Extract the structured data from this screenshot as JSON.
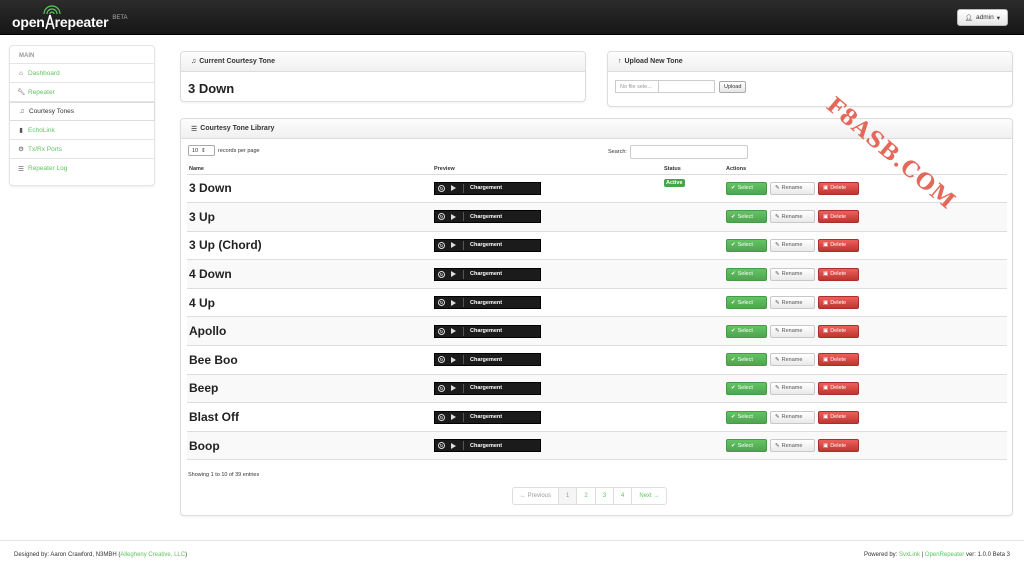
{
  "navbar": {
    "brand_prefix": "open",
    "brand_suffix": "repeater",
    "brand_beta": "BETA",
    "admin_label": "admin"
  },
  "sidebar": {
    "header": "MAIN",
    "items": [
      {
        "label": "Dashboard",
        "icon": "home-icon"
      },
      {
        "label": "Repeater",
        "icon": "wrench-icon"
      },
      {
        "label": "Courtesy Tones",
        "icon": "music-icon"
      },
      {
        "label": "EchoLink",
        "icon": "signal-icon"
      },
      {
        "label": "Tx/Rx Ports",
        "icon": "cog-icon"
      },
      {
        "label": "Repeater Log",
        "icon": "list-icon"
      }
    ]
  },
  "current_tone_panel": {
    "title": "Current Courtesy Tone",
    "value": "3 Down"
  },
  "upload_panel": {
    "title": "Upload New Tone",
    "file_placeholder": "No file sele...",
    "upload_label": "Upload"
  },
  "library": {
    "title": "Courtesy Tone Library",
    "page_length": "10",
    "records_label": "records per page",
    "search_label": "Search:",
    "columns": [
      "Name",
      "Preview",
      "Status",
      "Actions"
    ],
    "player_label": "Chargement",
    "status_active": "Active",
    "select_label": "Select",
    "rename_label": "Rename",
    "delete_label": "Delete",
    "rows": [
      {
        "name": "3 Down"
      },
      {
        "name": "3 Up"
      },
      {
        "name": "3 Up (Chord)"
      },
      {
        "name": "4 Down"
      },
      {
        "name": "4 Up"
      },
      {
        "name": "Apollo"
      },
      {
        "name": "Bee Boo"
      },
      {
        "name": "Beep"
      },
      {
        "name": "Blast Off"
      },
      {
        "name": "Boop"
      }
    ],
    "info": "Showing 1 to 10 of 39 entries",
    "pager": {
      "previous": "← Previous",
      "pages": [
        "1",
        "2",
        "3",
        "4"
      ],
      "next": "Next →"
    }
  },
  "watermark": "F8ASB.COM",
  "footer": {
    "left_prefix": "Designed by: Aaron Crawford, N3MBH (",
    "left_link": "Allegheny Creative, LLC",
    "left_suffix": ")",
    "right_prefix": "Powered by: ",
    "right_link1": "SvxLink",
    "right_sep": " | ",
    "right_link2": "OpenRepeater",
    "right_suffix": " ver: 1.0.0 Beta 3"
  },
  "colors": {
    "accent_green": "#62c462",
    "danger_red": "#bd362f",
    "navbar_dark": "#1b1b1b"
  }
}
